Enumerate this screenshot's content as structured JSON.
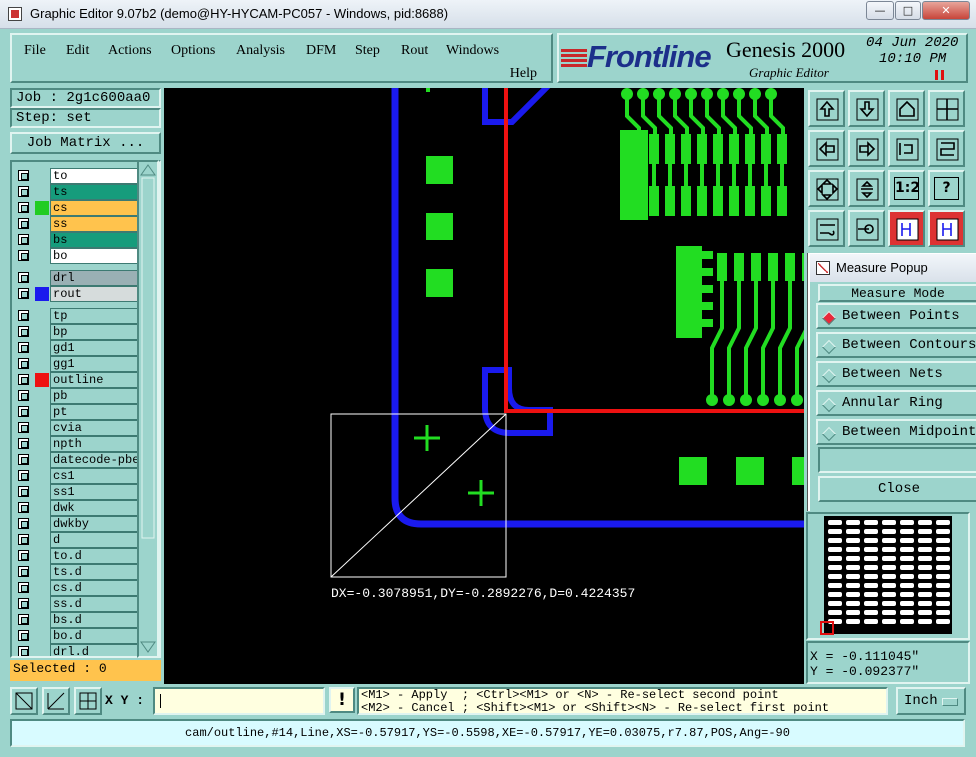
{
  "window": {
    "title": "Graphic Editor 9.07b2 (demo@HY-HYCAM-PC057 - Windows, pid:8688)",
    "min": "—",
    "max": "□",
    "close": "✕"
  },
  "menu": {
    "items": [
      "File",
      "Edit",
      "Actions",
      "Options",
      "Analysis",
      "DFM",
      "Step",
      "Rout",
      "Windows"
    ],
    "help": "Help"
  },
  "brand": {
    "logo": "Frontline",
    "product": "Genesis 2000",
    "subtitle": "Graphic Editor",
    "date": "04 Jun 2020",
    "time": "10:10 PM",
    "logo_color": "#1c2f8a"
  },
  "job": {
    "job_line": "Job : 2g1c600aa0",
    "step_line": "Step: set",
    "matrix_button": "Job Matrix ..."
  },
  "layers": [
    {
      "name": "to",
      "bg": "#ffffff",
      "swatch": ""
    },
    {
      "name": "ts",
      "bg": "#169c7c",
      "swatch": ""
    },
    {
      "name": "cs",
      "bg": "#ffc34d",
      "swatch": "#22cc22"
    },
    {
      "name": "ss",
      "bg": "#ffc34d",
      "swatch": ""
    },
    {
      "name": "bs",
      "bg": "#169c7c",
      "swatch": ""
    },
    {
      "name": "bo",
      "bg": "#ffffff",
      "swatch": ""
    },
    {
      "name": "drl",
      "bg": "#9ab0b4",
      "swatch": ""
    },
    {
      "name": "rout",
      "bg": "#d6dcdc",
      "swatch": "#1a1aee"
    },
    {
      "name": "tp",
      "bg": "#9cd4cc",
      "swatch": ""
    },
    {
      "name": "bp",
      "bg": "#9cd4cc",
      "swatch": ""
    },
    {
      "name": "gd1",
      "bg": "#9cd4cc",
      "swatch": ""
    },
    {
      "name": "gg1",
      "bg": "#9cd4cc",
      "swatch": ""
    },
    {
      "name": "outline",
      "bg": "#9cd4cc",
      "swatch": "#ee1111"
    },
    {
      "name": "pb",
      "bg": "#9cd4cc",
      "swatch": ""
    },
    {
      "name": "pt",
      "bg": "#9cd4cc",
      "swatch": ""
    },
    {
      "name": "cvia",
      "bg": "#9cd4cc",
      "swatch": ""
    },
    {
      "name": "npth",
      "bg": "#9cd4cc",
      "swatch": ""
    },
    {
      "name": "datecode-pbe",
      "bg": "#9cd4cc",
      "swatch": ""
    },
    {
      "name": "cs1",
      "bg": "#9cd4cc",
      "swatch": ""
    },
    {
      "name": "ss1",
      "bg": "#9cd4cc",
      "swatch": ""
    },
    {
      "name": "dwk",
      "bg": "#9cd4cc",
      "swatch": ""
    },
    {
      "name": "dwkby",
      "bg": "#9cd4cc",
      "swatch": ""
    },
    {
      "name": "d",
      "bg": "#9cd4cc",
      "swatch": ""
    },
    {
      "name": "to.d",
      "bg": "#9cd4cc",
      "swatch": ""
    },
    {
      "name": "ts.d",
      "bg": "#9cd4cc",
      "swatch": ""
    },
    {
      "name": "cs.d",
      "bg": "#9cd4cc",
      "swatch": ""
    },
    {
      "name": "ss.d",
      "bg": "#9cd4cc",
      "swatch": ""
    },
    {
      "name": "bs.d",
      "bg": "#9cd4cc",
      "swatch": ""
    },
    {
      "name": "bo.d",
      "bg": "#9cd4cc",
      "swatch": ""
    },
    {
      "name": "drl.d",
      "bg": "#9cd4cc",
      "swatch": ""
    }
  ],
  "selected": "Selected : 0",
  "measure_text": "DX=-0.3078951,DY=-0.2892276,D=0.4224357",
  "measure_popup": {
    "title": "Measure Popup",
    "mode_label": "Measure Mode",
    "options": [
      "Between Points",
      "Between Contours",
      "Between Nets",
      "Annular Ring",
      "Between Midpoints"
    ],
    "selected_index": 0,
    "close": "Close"
  },
  "toolbar_icons": [
    "zoom-in-icon",
    "zoom-out-icon",
    "home-icon",
    "window-icon",
    "pan-left-icon",
    "pan-right-icon",
    "flip-icon",
    "snap-icon",
    "zoom-fit-icon",
    "zoom-center-icon",
    "scale-1-2-icon",
    "help-icon",
    "tools-icon",
    "probe-icon",
    "net-icon-1",
    "net-icon-2"
  ],
  "toolbar_texts": {
    "scale": "1:2",
    "help": "?"
  },
  "coords": {
    "x": "X = -0.111045\"",
    "y": "Y = -0.092377\""
  },
  "bottom": {
    "xy_label": "X Y :",
    "xy_value": "",
    "warn": "!",
    "hint1": "<M1> - Apply  ; <Ctrl><M1> or <N> - Re-select second point",
    "hint2": "<M2> - Cancel ; <Shift><M1> or <Shift><N> - Re-select first point",
    "unit": "Inch"
  },
  "status": "cam/outline,#14,Line,XS=-0.57917,YS=-0.5598,XE=-0.57917,YE=0.03075,r7.87,POS,Ang=-90",
  "colors": {
    "canvas": "#000000",
    "signal": "#22dd22",
    "outline": "#ee1111",
    "rout": "#1a1aee",
    "panel": "#9cd4cc"
  }
}
